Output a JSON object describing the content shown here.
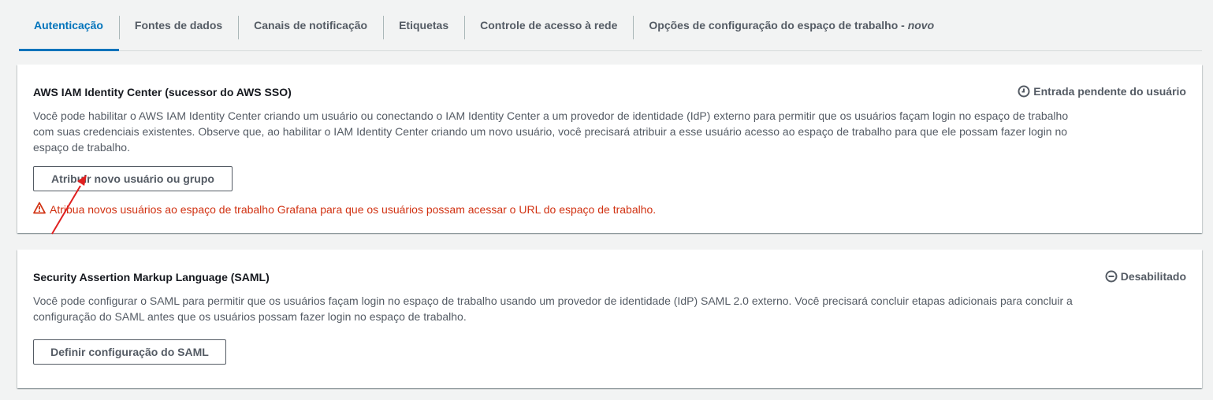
{
  "tabs": [
    {
      "label": "Autenticação",
      "active": true
    },
    {
      "label": "Fontes de dados"
    },
    {
      "label": "Canais de notificação"
    },
    {
      "label": "Etiquetas"
    },
    {
      "label": "Controle de acesso à rede"
    },
    {
      "label": "Opções de configuração do espaço de trabalho - ",
      "suffix": "novo"
    }
  ],
  "iam": {
    "title": "AWS IAM Identity Center (sucessor do AWS SSO)",
    "status_icon": "clock-icon",
    "status": "Entrada pendente do usuário",
    "description": "Você pode habilitar o AWS IAM Identity Center criando um usuário ou conectando o IAM Identity Center a um provedor de identidade (IdP) externo para permitir que os usuários façam login no espaço de trabalho com suas credenciais existentes. Observe que, ao habilitar o IAM Identity Center criando um novo usuário, você precisará atribuir a esse usuário acesso ao espaço de trabalho para que ele possam fazer login no espaço de trabalho.",
    "button_label": "Atribuir novo usuário ou grupo",
    "warning_icon": "warning-triangle-icon",
    "warning": "Atribua novos usuários ao espaço de trabalho Grafana para que os usuários possam acessar o URL do espaço de trabalho."
  },
  "saml": {
    "title": "Security Assertion Markup Language (SAML)",
    "status_icon": "minus-circle-icon",
    "status": "Desabilitado",
    "description": "Você pode configurar o SAML para permitir que os usuários façam login no espaço de trabalho usando um provedor de identidade (IdP) SAML 2.0 externo. Você precisará concluir etapas adicionais para concluir a configuração do SAML antes que os usuários possam fazer login no espaço de trabalho.",
    "button_label": "Definir configuração do SAML"
  },
  "colors": {
    "accent": "#0073bb",
    "error": "#d13212",
    "annotation_arrow": "#e02020"
  }
}
